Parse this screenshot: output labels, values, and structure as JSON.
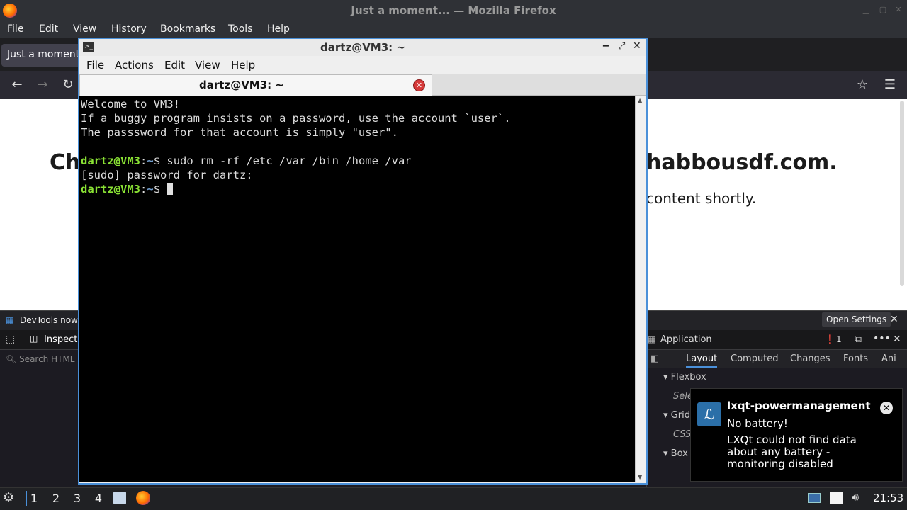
{
  "firefox": {
    "window_title": "Just a moment... — Mozilla Firefox",
    "menu": [
      "File",
      "Edit",
      "View",
      "History",
      "Bookmarks",
      "Tools",
      "Help"
    ],
    "tab_title": "Just a moment...",
    "page_heading_left": "Ch",
    "page_heading_right": "habbousdf.com.",
    "page_subtext": "content shortly."
  },
  "devtools": {
    "notice": "DevTools now f",
    "open_settings": "Open Settings",
    "inspector_tab": "Inspecto",
    "application_label": "Application",
    "error_count": "1",
    "search_placeholder": "Search HTML",
    "right_tabs": [
      "Layout",
      "Computed",
      "Changes",
      "Fonts",
      "Ani"
    ],
    "sections": [
      "Flexbox",
      "Grid",
      "Box"
    ],
    "flexbox_hint": "Sele",
    "grid_hint": "CSS"
  },
  "terminal": {
    "window_title": "dartz@VM3: ~",
    "menu": [
      "File",
      "Actions",
      "Edit",
      "View",
      "Help"
    ],
    "tab_title": "dartz@VM3: ~",
    "lines": [
      "Welcome to VM3!",
      "If a buggy program insists on a password, use the account `user`.",
      "The passsword for that account is simply \"user\"."
    ],
    "prompt_user": "dartz@VM3",
    "prompt_dir": "~",
    "prompt_symbol": "$",
    "command": " sudo rm -rf /etc /var /bin /home /var",
    "sudo_prompt": "[sudo] password for dartz:"
  },
  "notification": {
    "title": "lxqt-powermanagement",
    "line1": "No battery!",
    "line2": "LXQt could not find data about any battery - monitoring disabled"
  },
  "taskbar": {
    "workspaces": [
      "1",
      "2",
      "3",
      "4"
    ],
    "clock": "21:53"
  }
}
